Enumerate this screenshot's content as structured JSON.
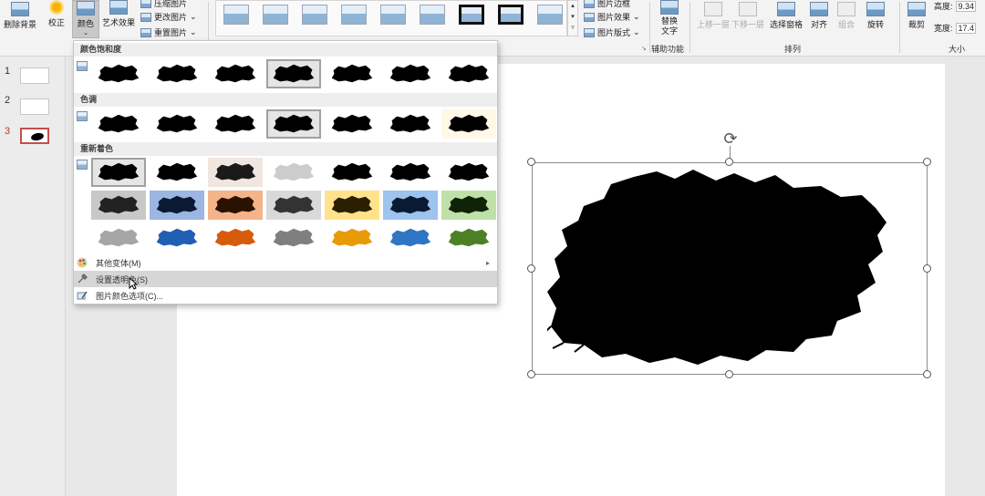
{
  "ribbon": {
    "remove_bg": "删除背景",
    "corrections": "校正",
    "color": "颜色",
    "artistic": "艺术效果",
    "compress": "压缩图片",
    "change_picture": "更改图片",
    "reset_picture": "重置图片",
    "picture_border": "图片边框",
    "picture_effects": "图片效果",
    "picture_layout": "图片版式",
    "alt_text": "替换文字",
    "accessibility_group": "辅助功能",
    "bring_forward": "上移一层",
    "send_backward": "下移一层",
    "selection_pane": "选择窗格",
    "align": "对齐",
    "group": "组合",
    "rotate": "旋转",
    "arrange_group": "排列",
    "crop": "裁剪",
    "height_label": "高度:",
    "height_value": "9.34",
    "width_label": "宽度:",
    "width_value": "17.4",
    "size_group": "大小"
  },
  "slides": [
    {
      "number": "1"
    },
    {
      "number": "2"
    },
    {
      "number": "3"
    }
  ],
  "color_menu": {
    "saturation_header": "颜色饱和度",
    "tone_header": "色调",
    "recolor_header": "重新着色",
    "more_variations": "其他变体(M)",
    "set_transparent": "设置透明色(S)",
    "picture_color_options": "图片颜色选项(C)..."
  },
  "colors": {
    "recolor_row2_bg": [
      "#c8c8c8",
      "#9bb6e3",
      "#f5b38a",
      "#d9d9d9",
      "#ffe28a",
      "#9dc3ee",
      "#bfe0a8"
    ],
    "recolor_row3_blob": [
      "#a6a6a6",
      "#1f5fb4",
      "#d65b0c",
      "#7f7f7f",
      "#e79b07",
      "#2e75c3",
      "#4d7f27"
    ],
    "accent_slide": "#c0504d"
  }
}
